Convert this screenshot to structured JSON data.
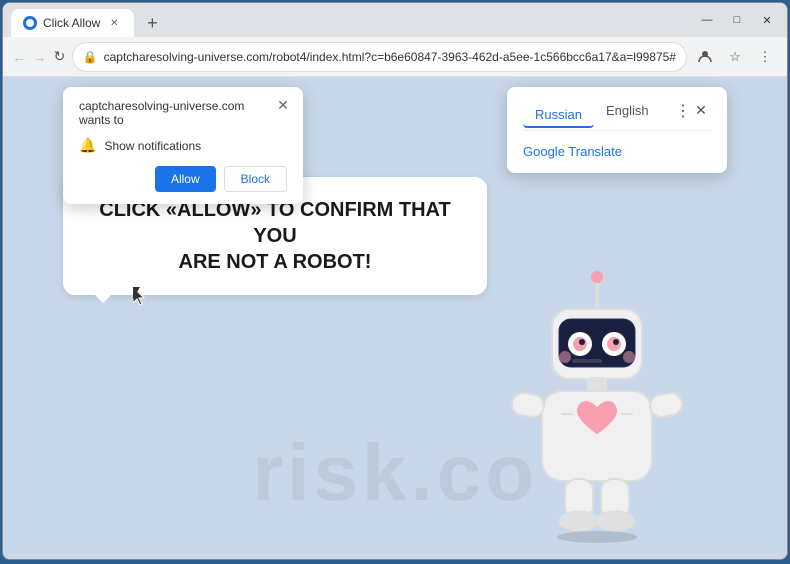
{
  "window": {
    "title": "Click Allow",
    "tab_label": "Click Allow",
    "close_label": "✕",
    "minimize_label": "—",
    "maximize_label": "□"
  },
  "toolbar": {
    "url": "captcharesolving-universe.com/robot4/index.html?c=b6e60847-3963-462d-a5ee-1c566bcc6a17&a=l99875#",
    "back_label": "←",
    "forward_label": "→",
    "reload_label": "↻",
    "new_tab_label": "+",
    "more_label": "⋮",
    "star_label": "☆",
    "account_label": "👤"
  },
  "notification_popup": {
    "site": "captcharesolving-universe.com wants to",
    "notification_text": "Show notifications",
    "allow_label": "Allow",
    "block_label": "Block",
    "close_label": "✕"
  },
  "translate_popup": {
    "tab_russian": "Russian",
    "tab_english": "English",
    "link_label": "Google Translate",
    "close_label": "✕",
    "more_label": "⋮"
  },
  "main_message": {
    "line1": "CLICK «ALLOW» TO CONFIRM THAT YOU",
    "line2": "ARE NOT A ROBOT!"
  },
  "watermark": {
    "text": "risk.co"
  }
}
